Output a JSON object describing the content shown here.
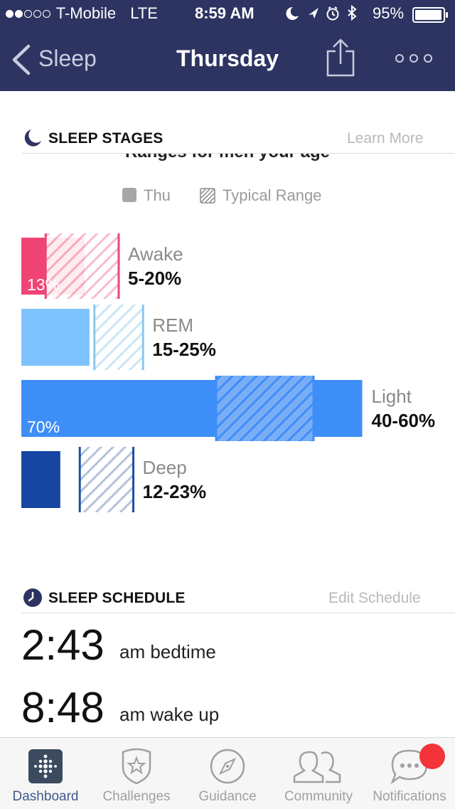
{
  "status_bar": {
    "carrier": "T-Mobile",
    "network": "LTE",
    "time": "8:59 AM",
    "battery": "95%"
  },
  "nav": {
    "back_label": "Sleep",
    "title": "Thursday"
  },
  "sleep_stages": {
    "heading": "SLEEP STAGES",
    "learn_more": "Learn More",
    "ranges_caption": "Ranges for men your age",
    "legend_thu": "Thu",
    "legend_typical": "Typical Range"
  },
  "chart_data": {
    "type": "bar",
    "categories": [
      "Awake",
      "REM",
      "Light",
      "Deep"
    ],
    "series": [
      {
        "name": "Thu",
        "values": [
          13,
          14,
          70,
          8
        ]
      }
    ],
    "typical_ranges": [
      [
        5,
        20
      ],
      [
        15,
        25
      ],
      [
        40,
        60
      ],
      [
        12,
        23
      ]
    ],
    "range_labels": [
      "5-20%",
      "15-25%",
      "40-60%",
      "12-23%"
    ],
    "value_labels": [
      "13%",
      "",
      "70%",
      ""
    ],
    "colors": [
      "#f04474",
      "#7ec3ff",
      "#3e8ef7",
      "#1746a2"
    ]
  },
  "sleep_schedule": {
    "heading": "SLEEP SCHEDULE",
    "edit_link": "Edit Schedule",
    "bedtime_time": "2:43",
    "bedtime_label": "am bedtime",
    "wake_time": "8:48",
    "wake_label": "am wake up"
  },
  "tabbar": {
    "tabs": [
      {
        "label": "Dashboard",
        "icon": "fitbit-dots-icon",
        "active": true
      },
      {
        "label": "Challenges",
        "icon": "star-shield-icon",
        "active": false
      },
      {
        "label": "Guidance",
        "icon": "compass-icon",
        "active": false
      },
      {
        "label": "Community",
        "icon": "people-icon",
        "active": false
      },
      {
        "label": "Notifications",
        "icon": "chat-bubble-icon",
        "active": false,
        "badge_color": "#f4333a"
      }
    ]
  },
  "colors": {
    "header_bg": "#2d3461",
    "accent_active": "#3e5a8a"
  }
}
